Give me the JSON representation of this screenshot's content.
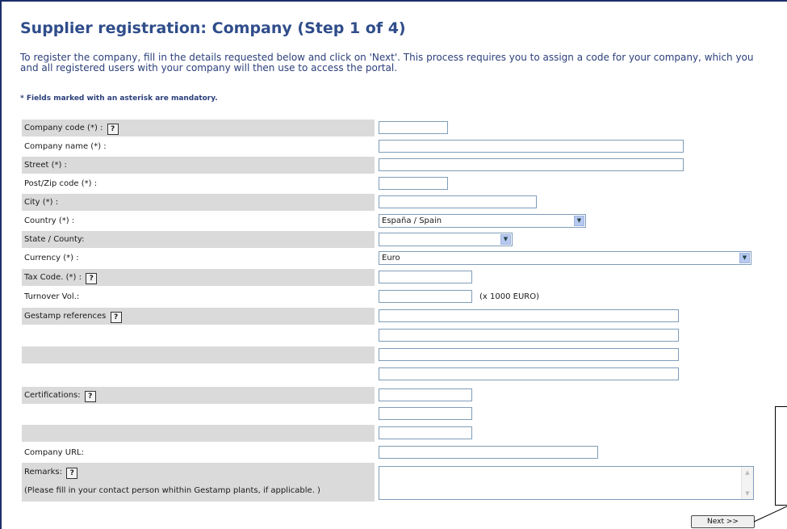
{
  "page": {
    "title": "Supplier registration: Company (Step 1 of 4)",
    "intro_line1": "To register the company, fill in the details requested below and click on 'Next'. This process requires you to assign a code for your company, which you",
    "intro_line2": "and all registered users with your company will then use to access the portal.",
    "mandatory_note": "* Fields marked with an asterisk are mandatory."
  },
  "form": {
    "company_code": {
      "label": "Company code (*) :",
      "value": ""
    },
    "company_name": {
      "label": "Company name (*) :",
      "value": ""
    },
    "street": {
      "label": "Street (*) :",
      "value": ""
    },
    "zip": {
      "label": "Post/Zip code (*) :",
      "value": ""
    },
    "city": {
      "label": "City (*) :",
      "value": ""
    },
    "country": {
      "label": "Country (*) :",
      "value": "España / Spain"
    },
    "state": {
      "label": "State / County:",
      "value": ""
    },
    "currency": {
      "label": "Currency (*) :",
      "value": "Euro"
    },
    "tax_code": {
      "label": "Tax Code. (*) :",
      "value": ""
    },
    "turnover": {
      "label": "Turnover Vol.:",
      "value": "",
      "unit": "(x 1000 EURO)"
    },
    "references": {
      "label": "Gestamp references"
    },
    "certifications": {
      "label": "Certifications:"
    },
    "url": {
      "label": "Company URL:",
      "value": ""
    },
    "remarks": {
      "label": "Remarks:",
      "hint": "(Please fill in your contact person whithin Gestamp plants, if applicable. )"
    }
  },
  "help_glyph": "?",
  "next_label": "Next >>",
  "icons": {
    "help": "help-icon",
    "dropdown": "chevron-down-icon"
  }
}
